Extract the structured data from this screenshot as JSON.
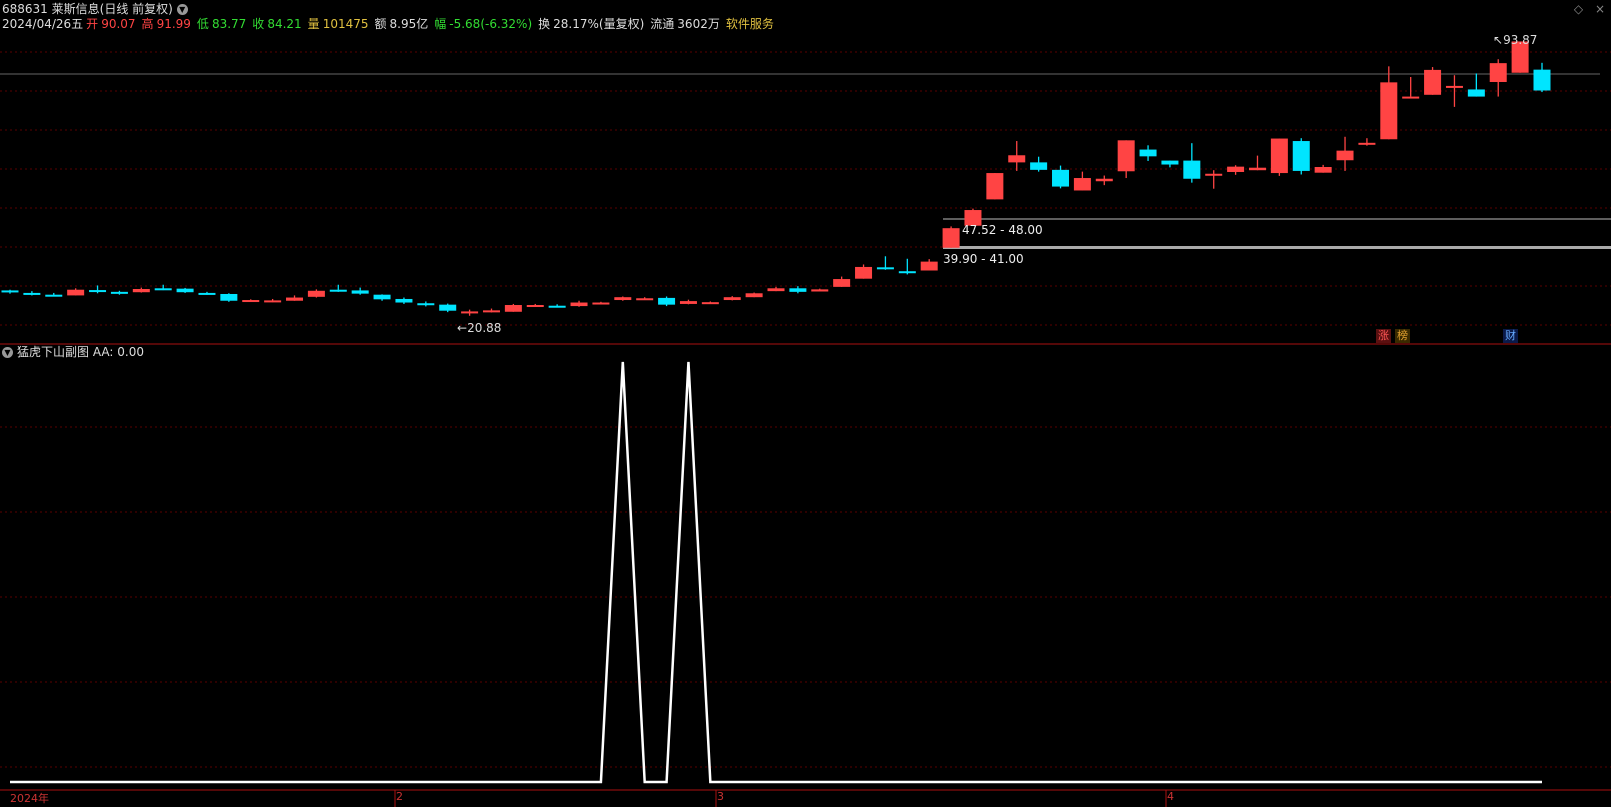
{
  "header": {
    "code": "688631",
    "name": "莱斯信息",
    "period": "(日线 前复权)",
    "date": "2024/04/26五",
    "open_label": "开",
    "open": "90.07",
    "high_label": "高",
    "high": "91.99",
    "low_label": "低",
    "low": "83.77",
    "close_label": "收",
    "close": "84.21",
    "vol_label": "量",
    "vol": "101475",
    "amt_label": "额",
    "amt": "8.95亿",
    "chg_label": "幅",
    "chg": "-5.68(-6.32%)",
    "turn_label": "换",
    "turn": "28.17%(量复权)",
    "float_label": "流通",
    "float": "3602万",
    "industry": "软件服务"
  },
  "topright": {
    "diamond": "◇",
    "close": "×"
  },
  "annotations": {
    "high_label": "93.87",
    "low_label": "20.88",
    "band1": "47.52 - 48.00",
    "band2": "39.90 - 41.00"
  },
  "tags": {
    "zhang": "涨",
    "bang": "榜",
    "cai": "财"
  },
  "sub_indicator": {
    "name": "猛虎下山副图",
    "value_label": "AA: 0.00"
  },
  "date_axis": {
    "year": "2024年",
    "m2": "2",
    "m3": "3",
    "m4": "4"
  },
  "colors": {
    "up": "#ff4444",
    "down": "#00e5ff",
    "grid": "#5a0000",
    "line": "#ffffff"
  },
  "chart_data": {
    "type": "candlestick",
    "title": "",
    "ohlc": [
      [
        28,
        28.2,
        27.1,
        27.5
      ],
      [
        27.3,
        27.8,
        26.6,
        26.9
      ],
      [
        26.8,
        27.3,
        26.4,
        26.7
      ],
      [
        26.6,
        28.6,
        26.6,
        28.2
      ],
      [
        28.1,
        29.4,
        27.2,
        27.6
      ],
      [
        27.6,
        27.9,
        26.8,
        27.4
      ],
      [
        27.5,
        28.8,
        27.4,
        28.4
      ],
      [
        28.6,
        29.6,
        28.1,
        28.4
      ],
      [
        28.5,
        28.7,
        27.3,
        27.5
      ],
      [
        27.3,
        27.6,
        26.8,
        27.1
      ],
      [
        27.0,
        27.2,
        24.8,
        25.1
      ],
      [
        25.3,
        25.5,
        24.9,
        25.3
      ],
      [
        24.9,
        25.6,
        24.7,
        25.2
      ],
      [
        25.1,
        26.6,
        25.1,
        26.0
      ],
      [
        26.2,
        28.3,
        26.0,
        27.9
      ],
      [
        28.2,
        29.6,
        27.6,
        27.9
      ],
      [
        28.0,
        28.8,
        26.8,
        27.1
      ],
      [
        26.8,
        26.9,
        25.1,
        25.5
      ],
      [
        25.6,
        26.0,
        24.2,
        24.6
      ],
      [
        24.4,
        24.9,
        23.5,
        23.9
      ],
      [
        24.0,
        24.3,
        21.9,
        22.3
      ],
      [
        21.6,
        22.6,
        20.88,
        22.1
      ],
      [
        22.2,
        22.9,
        21.8,
        22.4
      ],
      [
        22.0,
        24.2,
        22.0,
        23.9
      ],
      [
        23.8,
        24.2,
        23.4,
        23.9
      ],
      [
        23.7,
        24.1,
        23.4,
        23.6
      ],
      [
        23.6,
        25.1,
        23.4,
        24.6
      ],
      [
        24.6,
        24.8,
        24.3,
        24.6
      ],
      [
        25.3,
        26.3,
        25.1,
        26.1
      ],
      [
        25.8,
        26.1,
        25.6,
        25.8
      ],
      [
        25.9,
        26.3,
        23.6,
        24.0
      ],
      [
        24.2,
        25.4,
        24.1,
        25.0
      ],
      [
        24.7,
        24.9,
        24.5,
        24.7
      ],
      [
        25.3,
        26.4,
        25.2,
        26.1
      ],
      [
        26.1,
        27.4,
        26.1,
        27.2
      ],
      [
        27.8,
        29.0,
        27.8,
        28.6
      ],
      [
        28.6,
        29.2,
        27.2,
        27.6
      ],
      [
        27.7,
        28.5,
        27.7,
        28.3
      ],
      [
        29.0,
        31.9,
        29.0,
        31.2
      ],
      [
        31.3,
        35.3,
        31.3,
        34.6
      ],
      [
        34.5,
        37.6,
        33.8,
        34.2
      ],
      [
        33.4,
        36.9,
        32.5,
        33.0
      ],
      [
        33.6,
        36.8,
        33.6,
        36.1
      ],
      [
        40.0,
        46.0,
        40.0,
        45.5
      ],
      [
        46.2,
        51.0,
        46.2,
        50.6
      ],
      [
        53.6,
        60.2,
        53.6,
        61.0
      ],
      [
        64.0,
        70.0,
        61.6,
        66.0
      ],
      [
        64.0,
        65.6,
        61.4,
        61.9
      ],
      [
        61.9,
        63.1,
        56.7,
        57.2
      ],
      [
        56.1,
        61.4,
        56.1,
        59.6
      ],
      [
        58.7,
        60.3,
        57.6,
        59.4
      ],
      [
        61.5,
        70.2,
        59.6,
        70.2
      ],
      [
        67.6,
        68.8,
        64.4,
        65.7
      ],
      [
        64.5,
        64.5,
        62.6,
        63.4
      ],
      [
        64.5,
        69.4,
        58.3,
        59.4
      ],
      [
        60.5,
        61.8,
        56.6,
        60.8
      ],
      [
        61.3,
        63.2,
        60.5,
        62.8
      ],
      [
        61.8,
        65.9,
        61.8,
        62.5
      ],
      [
        61.0,
        67.8,
        60.2,
        70.7
      ],
      [
        70.0,
        70.8,
        60.6,
        61.6
      ],
      [
        61.1,
        63.3,
        61.1,
        62.7
      ],
      [
        64.6,
        71.2,
        61.6,
        67.3
      ],
      [
        69.1,
        70.8,
        68.7,
        69.5
      ],
      [
        70.5,
        91.0,
        70.5,
        86.5
      ],
      [
        82.5,
        88.0,
        86.0,
        82.5
      ],
      [
        83.0,
        90.8,
        83.0,
        90.0
      ],
      [
        85.5,
        88.5,
        79.6,
        85.5
      ],
      [
        84.5,
        89.0,
        84.5,
        82.5
      ],
      [
        86.6,
        93.0,
        82.5,
        91.9
      ],
      [
        89.2,
        93.87,
        89.2,
        98.0
      ],
      [
        90.07,
        91.99,
        83.77,
        84.21
      ]
    ],
    "price_range": [
      18,
      97
    ],
    "price_labels": {
      "high": 93.87,
      "low": 20.88
    },
    "indicator": {
      "name": "猛虎下山副图",
      "series": "AA",
      "current": 0.0,
      "values": [
        0,
        0,
        0,
        0,
        0,
        0,
        0,
        0,
        0,
        0,
        0,
        0,
        0,
        0,
        0,
        0,
        0,
        0,
        0,
        0,
        0,
        0,
        0,
        0,
        0,
        0,
        0,
        0,
        1,
        0,
        0,
        1,
        0,
        0,
        0,
        0,
        0,
        0,
        0,
        0,
        0,
        0,
        0,
        0,
        0,
        0,
        0,
        0,
        0,
        0,
        0,
        0,
        0,
        0,
        0,
        0,
        0,
        0,
        0,
        0,
        0,
        0,
        0,
        0,
        0,
        0,
        0,
        0,
        0,
        0,
        0
      ]
    }
  }
}
